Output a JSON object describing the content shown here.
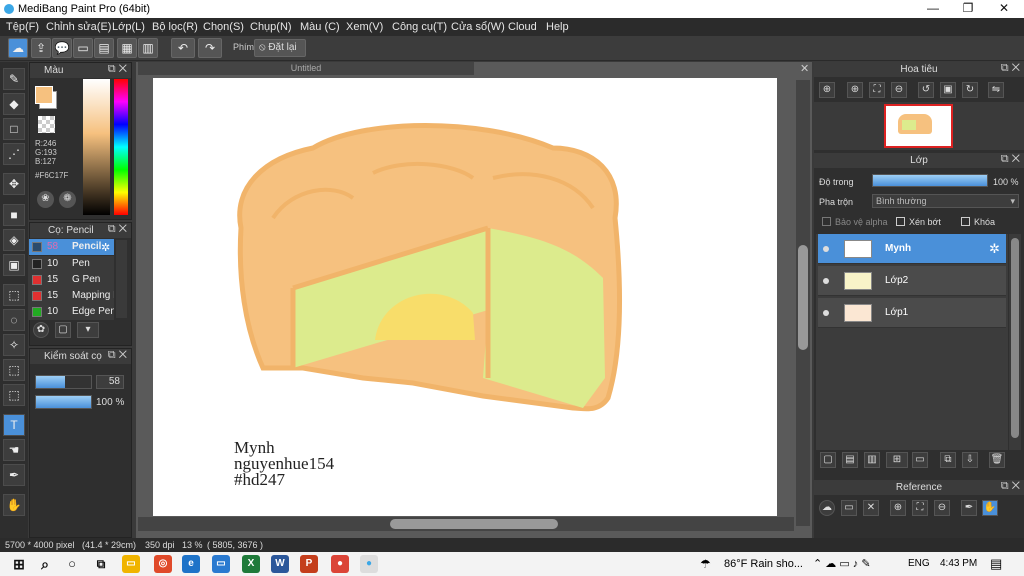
{
  "app": {
    "title": "MediBang Paint Pro (64bit)"
  },
  "window": {
    "minimize": "—",
    "maximize": "❐",
    "close": "✕"
  },
  "menu": [
    "Tệp(F)",
    "Chỉnh sửa(E)",
    "Lớp(L)",
    "Bộ lọc(R)",
    "Chọn(S)",
    "Chụp(N)",
    "Màu (C)",
    "Xem(V)",
    "Công cụ(T)",
    "Cửa sổ(W)",
    "Cloud",
    "Help"
  ],
  "toolbar": {
    "shortcut_label": "Phím",
    "reset_label": "Đặt lại"
  },
  "color_panel": {
    "title": "Màu",
    "r": "R:246",
    "g": "G:193",
    "b": "B:127",
    "hex": "#F6C17F",
    "fg": "#F6C17F",
    "bg": "#ffffff"
  },
  "brush_panel": {
    "title": "Cọ: Pencil",
    "items": [
      {
        "size": "58",
        "name": "Pencil",
        "color": "#2b4a6b"
      },
      {
        "size": "10",
        "name": "Pen",
        "color": "#222222"
      },
      {
        "size": "15",
        "name": "G Pen",
        "color": "#e03030"
      },
      {
        "size": "15",
        "name": "Mapping Pen",
        "color": "#e03030"
      },
      {
        "size": "10",
        "name": "Edge Pen",
        "color": "#22aa22"
      }
    ]
  },
  "brush_control": {
    "title": "Kiểm soát cọ",
    "size": "58",
    "opacity": "100 %",
    "size_fraction": 0.58,
    "opacity_fraction": 1.0
  },
  "canvas": {
    "tab": "Untitled"
  },
  "drawing_text": {
    "line1": "Mynh",
    "line2": "nguyenhue154",
    "line3": "#hd247"
  },
  "navigator": {
    "title": "Hoa tiêu"
  },
  "layer_panel": {
    "title": "Lớp",
    "opacity_label": "Độ trong",
    "opacity_value": "100 %",
    "opacity_fraction": 1.0,
    "blend_label": "Pha trộn",
    "blend_value": "Bình thường",
    "protect_alpha": "Bảo vệ alpha",
    "clipping": "Xén bớt",
    "lock": "Khóa",
    "layers": [
      {
        "name": "Mynh",
        "selected": true
      },
      {
        "name": "Lớp2",
        "selected": false
      },
      {
        "name": "Lớp1",
        "selected": false
      }
    ]
  },
  "reference": {
    "title": "Reference"
  },
  "status_bar": {
    "size": "5700 * 4000 pixel",
    "cm": "(41.4 * 29cm)",
    "dpi": "350 dpi",
    "zoom": "13 %",
    "coords": "( 5805, 3676 )"
  },
  "taskbar": {
    "weather": "86°F  Rain sho...",
    "lang": "ENG",
    "time": "4:43 PM"
  }
}
